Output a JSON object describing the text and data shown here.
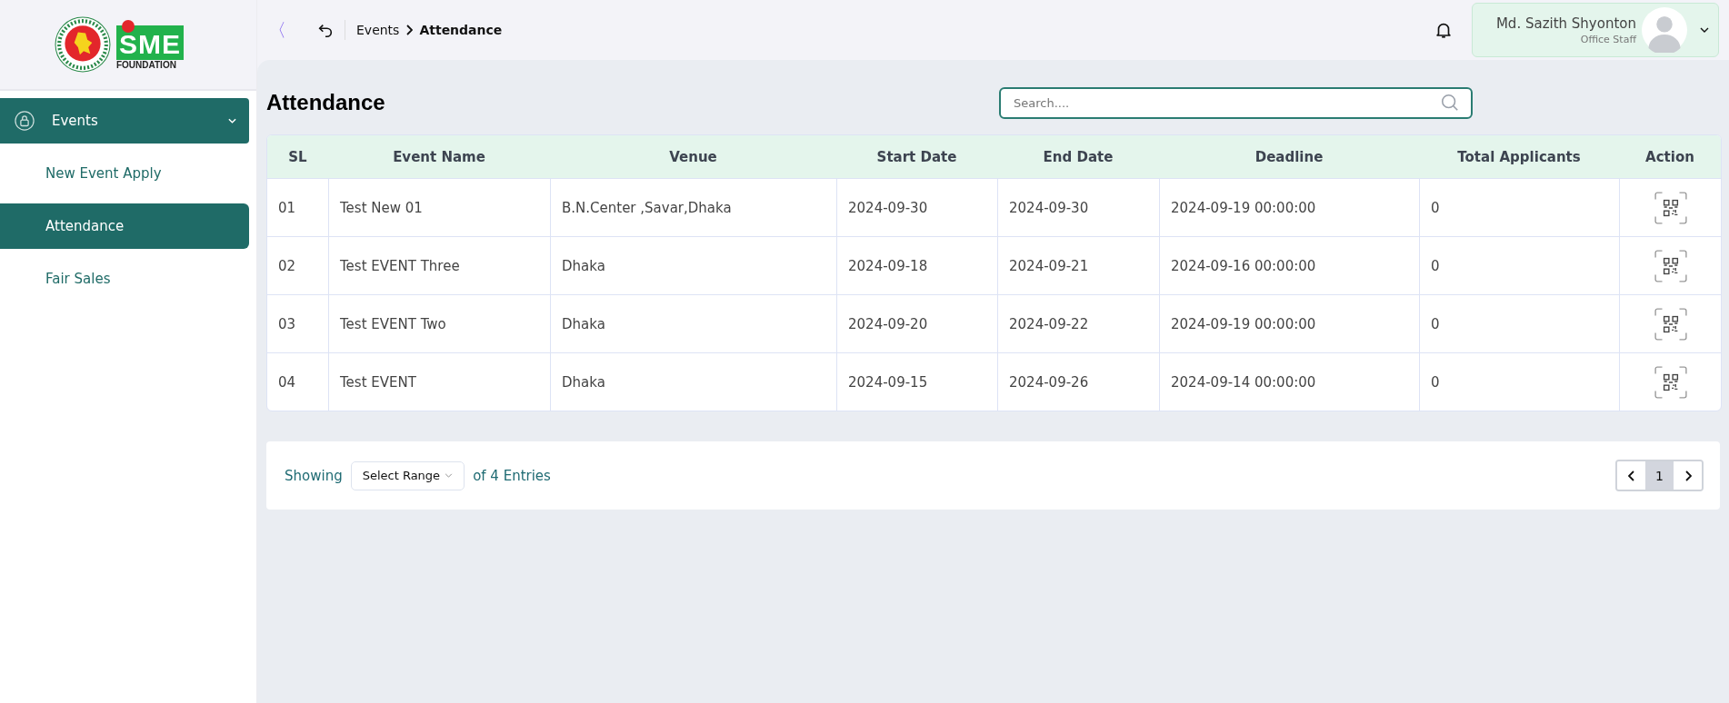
{
  "logo": {
    "mark": "SME",
    "caption": "FOUNDATION"
  },
  "sidebar": {
    "items": [
      {
        "label": "Events",
        "expanded": true,
        "children": [
          {
            "label": "New Event Apply",
            "selected": false
          },
          {
            "label": "Attendance",
            "selected": true
          },
          {
            "label": "Fair Sales",
            "selected": false
          }
        ]
      }
    ]
  },
  "header": {
    "collapse_glyph": "〈",
    "breadcrumb": [
      {
        "label": "Events",
        "current": false
      },
      {
        "label": "Attendance",
        "current": true
      }
    ],
    "user": {
      "name": "Md. Sazith Shyonton",
      "role": "Office Staff"
    }
  },
  "page_title": "Attendance",
  "search": {
    "placeholder": "Search...."
  },
  "table": {
    "columns": [
      "SL",
      "Event Name",
      "Venue",
      "Start Date",
      "End Date",
      "Deadline",
      "Total Applicants",
      "Action"
    ],
    "rows": [
      [
        "01",
        "Test New 01",
        "B.N.Center ,Savar,Dhaka",
        "2024-09-30",
        "2024-09-30",
        "2024-09-19 00:00:00",
        "0"
      ],
      [
        "02",
        "Test EVENT Three",
        "Dhaka",
        "2024-09-18",
        "2024-09-21",
        "2024-09-16 00:00:00",
        "0"
      ],
      [
        "03",
        "Test EVENT Two",
        "Dhaka",
        "2024-09-20",
        "2024-09-22",
        "2024-09-19 00:00:00",
        "0"
      ],
      [
        "04",
        "Test EVENT",
        "Dhaka",
        "2024-09-15",
        "2024-09-26",
        "2024-09-14 00:00:00",
        "0"
      ]
    ]
  },
  "pagination": {
    "showing": "Showing",
    "range": "Select Range",
    "entries": "of 4 Entries",
    "pages": [
      {
        "label": "1",
        "selected": true
      }
    ]
  }
}
